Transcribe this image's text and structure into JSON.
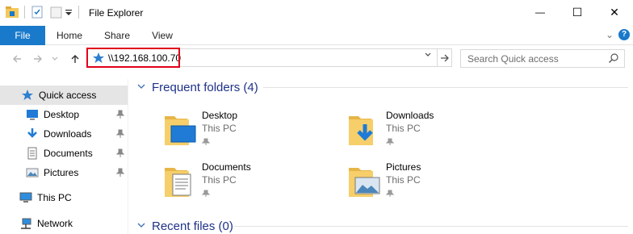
{
  "window": {
    "title": "File Explorer",
    "minimize": "—",
    "maximize": "☐",
    "close": "✕"
  },
  "ribbon": {
    "tabs": [
      {
        "label": "File"
      },
      {
        "label": "Home"
      },
      {
        "label": "Share"
      },
      {
        "label": "View"
      }
    ],
    "expand": "⌄",
    "help": "?"
  },
  "address": {
    "path": "\\\\192.168.100.70",
    "dropdown": "⌄",
    "go": "→"
  },
  "search": {
    "placeholder": "Search Quick access"
  },
  "nav": {
    "items": [
      {
        "label": "Quick access",
        "icon": "star-icon",
        "selected": true
      },
      {
        "label": "Desktop",
        "icon": "desktop-icon",
        "pinned": true
      },
      {
        "label": "Downloads",
        "icon": "download-icon",
        "pinned": true
      },
      {
        "label": "Documents",
        "icon": "documents-icon",
        "pinned": true
      },
      {
        "label": "Pictures",
        "icon": "pictures-icon",
        "pinned": true
      },
      {
        "label": "This PC",
        "icon": "computer-icon"
      },
      {
        "label": "Network",
        "icon": "network-icon"
      }
    ]
  },
  "frequent": {
    "title": "Frequent folders (4)",
    "folders": [
      {
        "name": "Desktop",
        "location": "This PC"
      },
      {
        "name": "Downloads",
        "location": "This PC"
      },
      {
        "name": "Documents",
        "location": "This PC"
      },
      {
        "name": "Pictures",
        "location": "This PC"
      }
    ]
  },
  "recent": {
    "title": "Recent files (0)"
  },
  "colors": {
    "accent": "#1979ca",
    "section_title": "#1e3287",
    "highlight": "#e0001a",
    "folder": "#f5c85a"
  }
}
